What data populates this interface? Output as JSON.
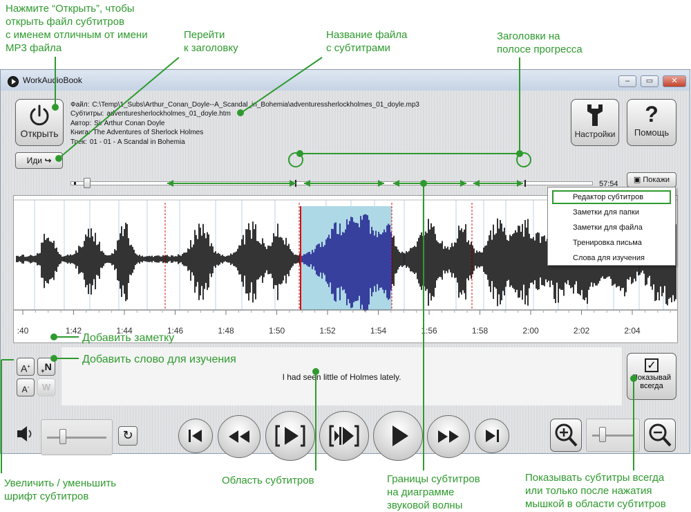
{
  "annotations": {
    "open_file": [
      "Нажмите “Открыть”, чтобы",
      "открыть файл субтитров",
      "с именем отличным от имени",
      "MP3 файла"
    ],
    "goto_header": [
      "Перейти",
      "к заголовку"
    ],
    "subtitle_filename": [
      "Название файла",
      "с субтитрами"
    ],
    "progress_headers": [
      "Заголовки на",
      "полосе прогресса"
    ],
    "add_note": "Добавить заметку",
    "add_word": "Добавить слово для изучения",
    "font_size": [
      "Увеличить / уменьшить",
      "шрифт субтитров"
    ],
    "subtitle_area": "Область субтитров",
    "subtitle_bounds": [
      "Границы субтитров",
      "на диаграмме",
      "звуковой волны"
    ],
    "show_always_note": [
      "Показывать субтитры всегда",
      "или только после нажатия",
      "мышкой в области субтитров"
    ]
  },
  "window": {
    "title": "WorkAudioBook",
    "minimize": "–",
    "restore": "▭",
    "close": "✕"
  },
  "toolbar": {
    "open_label": "Открыть",
    "settings_label": "Настройки",
    "help_label": "Помощь",
    "goto_label": "Иди",
    "show_label": "Покажи"
  },
  "file_info": {
    "file_label": "Файл:",
    "file_value": "C:\\Temp\\1_Subs\\Arthur_Conan_Doyle--A_Scandal_in_Bohemia\\adventuressherlockholmes_01_doyle.mp3",
    "subs_label": "Субтитры:",
    "subs_value": "adventuresherlockholmes_01_doyle.htm",
    "author_label": "Автор:",
    "author_value": "Sir Arthur Conan Doyle",
    "book_label": "Книга:",
    "book_value": "The Adventures of Sherlock Holmes",
    "track_label": "Трек:",
    "track_value": "01 - 01 - A Scandal in Bohemia"
  },
  "progress": {
    "total_time": "57:54",
    "position": 0.025
  },
  "menu": {
    "items": [
      "Редактор субтитров",
      "Заметки для папки",
      "Заметки для файла",
      "Тренировка письма",
      "Слова для изучения"
    ],
    "selected_index": 0
  },
  "timeline": {
    "ticks": [
      ":40",
      "1:42",
      "1:44",
      "1:46",
      "1:48",
      "1:50",
      "1:52",
      "1:54",
      "1:56",
      "1:58",
      "2:00",
      "2:02",
      "2:04"
    ]
  },
  "subtitles": {
    "current_text": "I had seen little of Holmes lately."
  },
  "show_always": {
    "label_line1": "Показывай",
    "label_line2": "всегда"
  },
  "colors": {
    "annotation_green": "#2e9a2e",
    "selection_blue": "#add8e6",
    "subtitle_boundary_red": "#d01010",
    "waveform_dark": "#000000",
    "waveform_selected": "#1a1a8c"
  },
  "icons": [
    "power-icon",
    "wrench-icon",
    "question-icon",
    "goto-arrow-icon",
    "subtitle-icon",
    "speaker-icon",
    "repeat-icon",
    "prev-icon",
    "rewind-icon",
    "replay-bracket-icon",
    "play-bracket-icon",
    "play-icon",
    "fast-forward-icon",
    "next-icon",
    "zoom-in-icon",
    "zoom-out-icon",
    "checkbox-icon"
  ]
}
